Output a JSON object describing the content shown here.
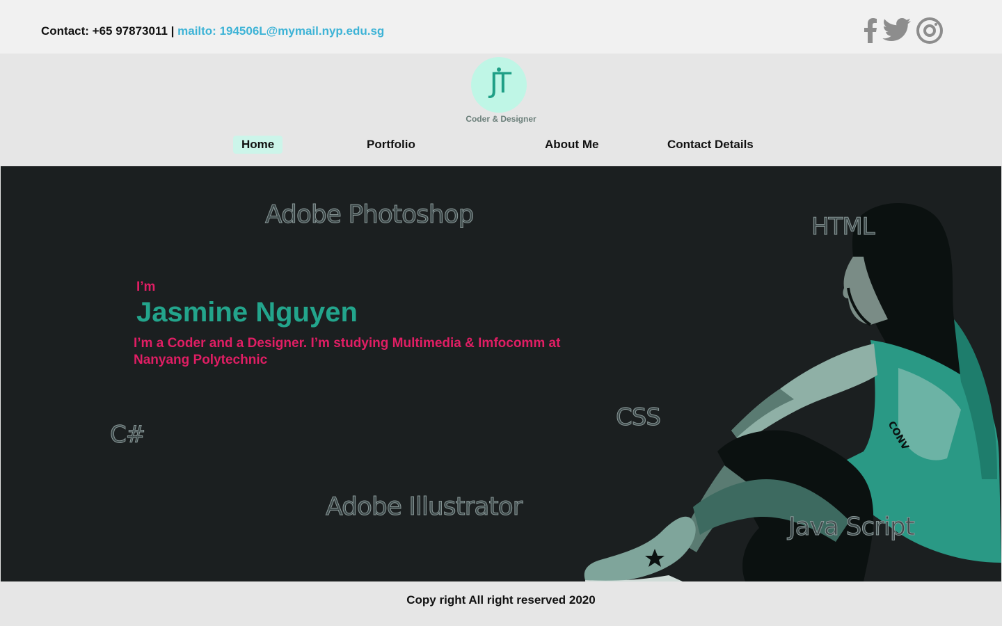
{
  "topbar": {
    "contact_label": "Contact: +65 97873011 | ",
    "email_link": "mailto: 194506L@mymail.nyp.edu.sg",
    "social": [
      "facebook-icon",
      "twitter-icon",
      "instagram-icon"
    ]
  },
  "header": {
    "logo_text": "JT",
    "tagline": "Coder & Designer"
  },
  "nav": {
    "items": [
      "Home",
      "Portfolio",
      "About Me",
      "Contact Details"
    ],
    "active": "Home"
  },
  "hero": {
    "intro_prefix": "I’m",
    "name": "Jasmine Nguyen",
    "description": "I’m a Coder and a Designer. I’m studying Multimedia & Imfocomm at Nanyang Polytechnic",
    "skills": {
      "photoshop": "Adobe Photoshop",
      "html": "HTML",
      "csharp": "C#",
      "css": "CSS",
      "illustrator": "Adobe Illustrator",
      "javascript": "Java Script"
    }
  },
  "footer": {
    "copyright": "Copy right All right reserved 2020"
  },
  "colors": {
    "accent_teal": "#23a58c",
    "accent_pink": "#e01e64",
    "link_blue": "#3db3d6",
    "hero_bg": "#1b1f20"
  }
}
